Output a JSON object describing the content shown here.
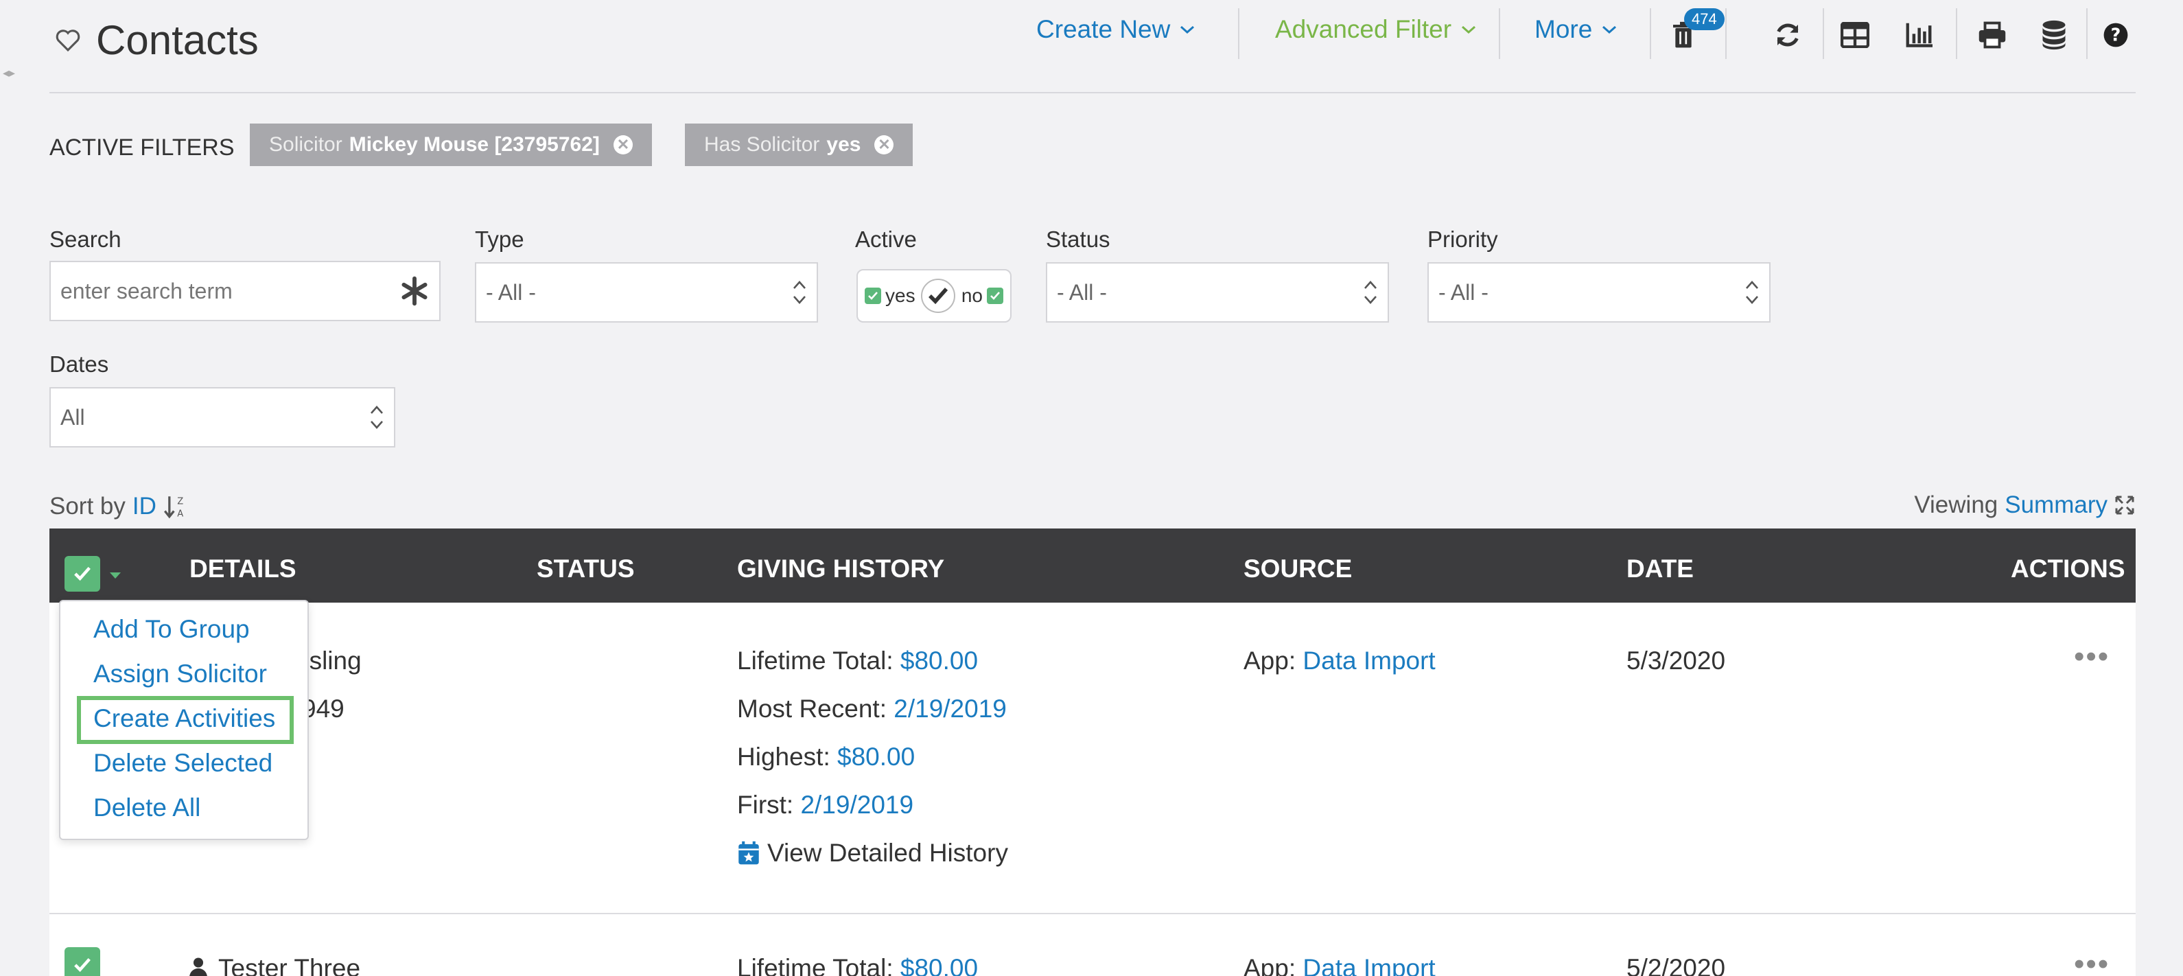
{
  "header": {
    "title": "Contacts",
    "create_new": "Create New",
    "advanced_filter": "Advanced Filter",
    "more": "More",
    "trash_count": "474"
  },
  "colors": {
    "link": "#1a7bc0",
    "advanced_filter": "#7ab648",
    "check": "#5cb87a",
    "table_header": "#3c3c3e",
    "chip": "#a8a8ac",
    "highlight": "#6cc06c"
  },
  "filters": {
    "active_label": "ACTIVE FILTERS",
    "chips": [
      {
        "key": "Solicitor",
        "value": "Mickey Mouse [23795762]"
      },
      {
        "key": "Has Solicitor",
        "value": "yes"
      }
    ],
    "search_label": "Search",
    "search_placeholder": "enter search term",
    "type_label": "Type",
    "type_value": "- All -",
    "active_label2": "Active",
    "active_yes": "yes",
    "active_no": "no",
    "status_label": "Status",
    "status_value": "- All -",
    "priority_label": "Priority",
    "priority_value": "- All -",
    "dates_label": "Dates",
    "dates_value": "All"
  },
  "sort": {
    "label": "Sort by",
    "field": "ID",
    "viewing_label": "Viewing",
    "viewing_value": "Summary"
  },
  "table": {
    "headers": [
      "DETAILS",
      "STATUS",
      "GIVING HISTORY",
      "SOURCE",
      "DATE",
      "ACTIONS"
    ],
    "rows": [
      {
        "name_partial": "osling",
        "id_partial": "949",
        "lifetime_label": "Lifetime Total:",
        "lifetime": "$80.00",
        "recent_label": "Most Recent:",
        "recent": "2/19/2019",
        "highest_label": "Highest:",
        "highest": "$80.00",
        "first_label": "First:",
        "first": "2/19/2019",
        "history_link": "View Detailed History",
        "source_label": "App:",
        "source": "Data Import",
        "date": "5/3/2020"
      },
      {
        "name": "Tester Three",
        "lifetime_label": "Lifetime Total:",
        "lifetime": "$80.00",
        "source_label": "App:",
        "source": "Data Import",
        "date": "5/2/2020"
      }
    ]
  },
  "bulk_menu": [
    "Add To Group",
    "Assign Solicitor",
    "Create Activities",
    "Delete Selected",
    "Delete All"
  ]
}
